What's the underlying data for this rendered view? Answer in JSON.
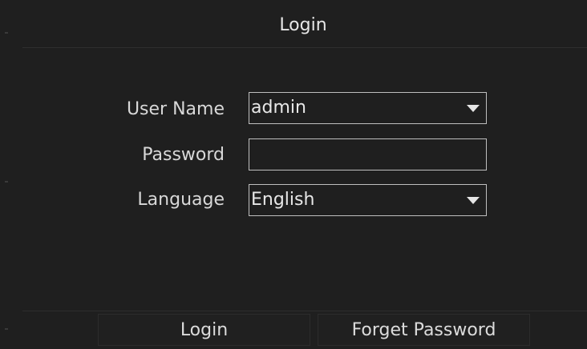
{
  "dialog": {
    "title": "Login"
  },
  "form": {
    "username": {
      "label": "User Name",
      "value": "admin"
    },
    "password": {
      "label": "Password",
      "value": ""
    },
    "language": {
      "label": "Language",
      "value": "English"
    }
  },
  "buttons": {
    "login_label": "Login",
    "forget_label": "Forget Password"
  },
  "icons": {
    "dropdown": "chevron-down-icon"
  },
  "colors": {
    "background": "#1f1f1f",
    "text": "#e6e6e6",
    "field_border": "#bfbfbf"
  }
}
